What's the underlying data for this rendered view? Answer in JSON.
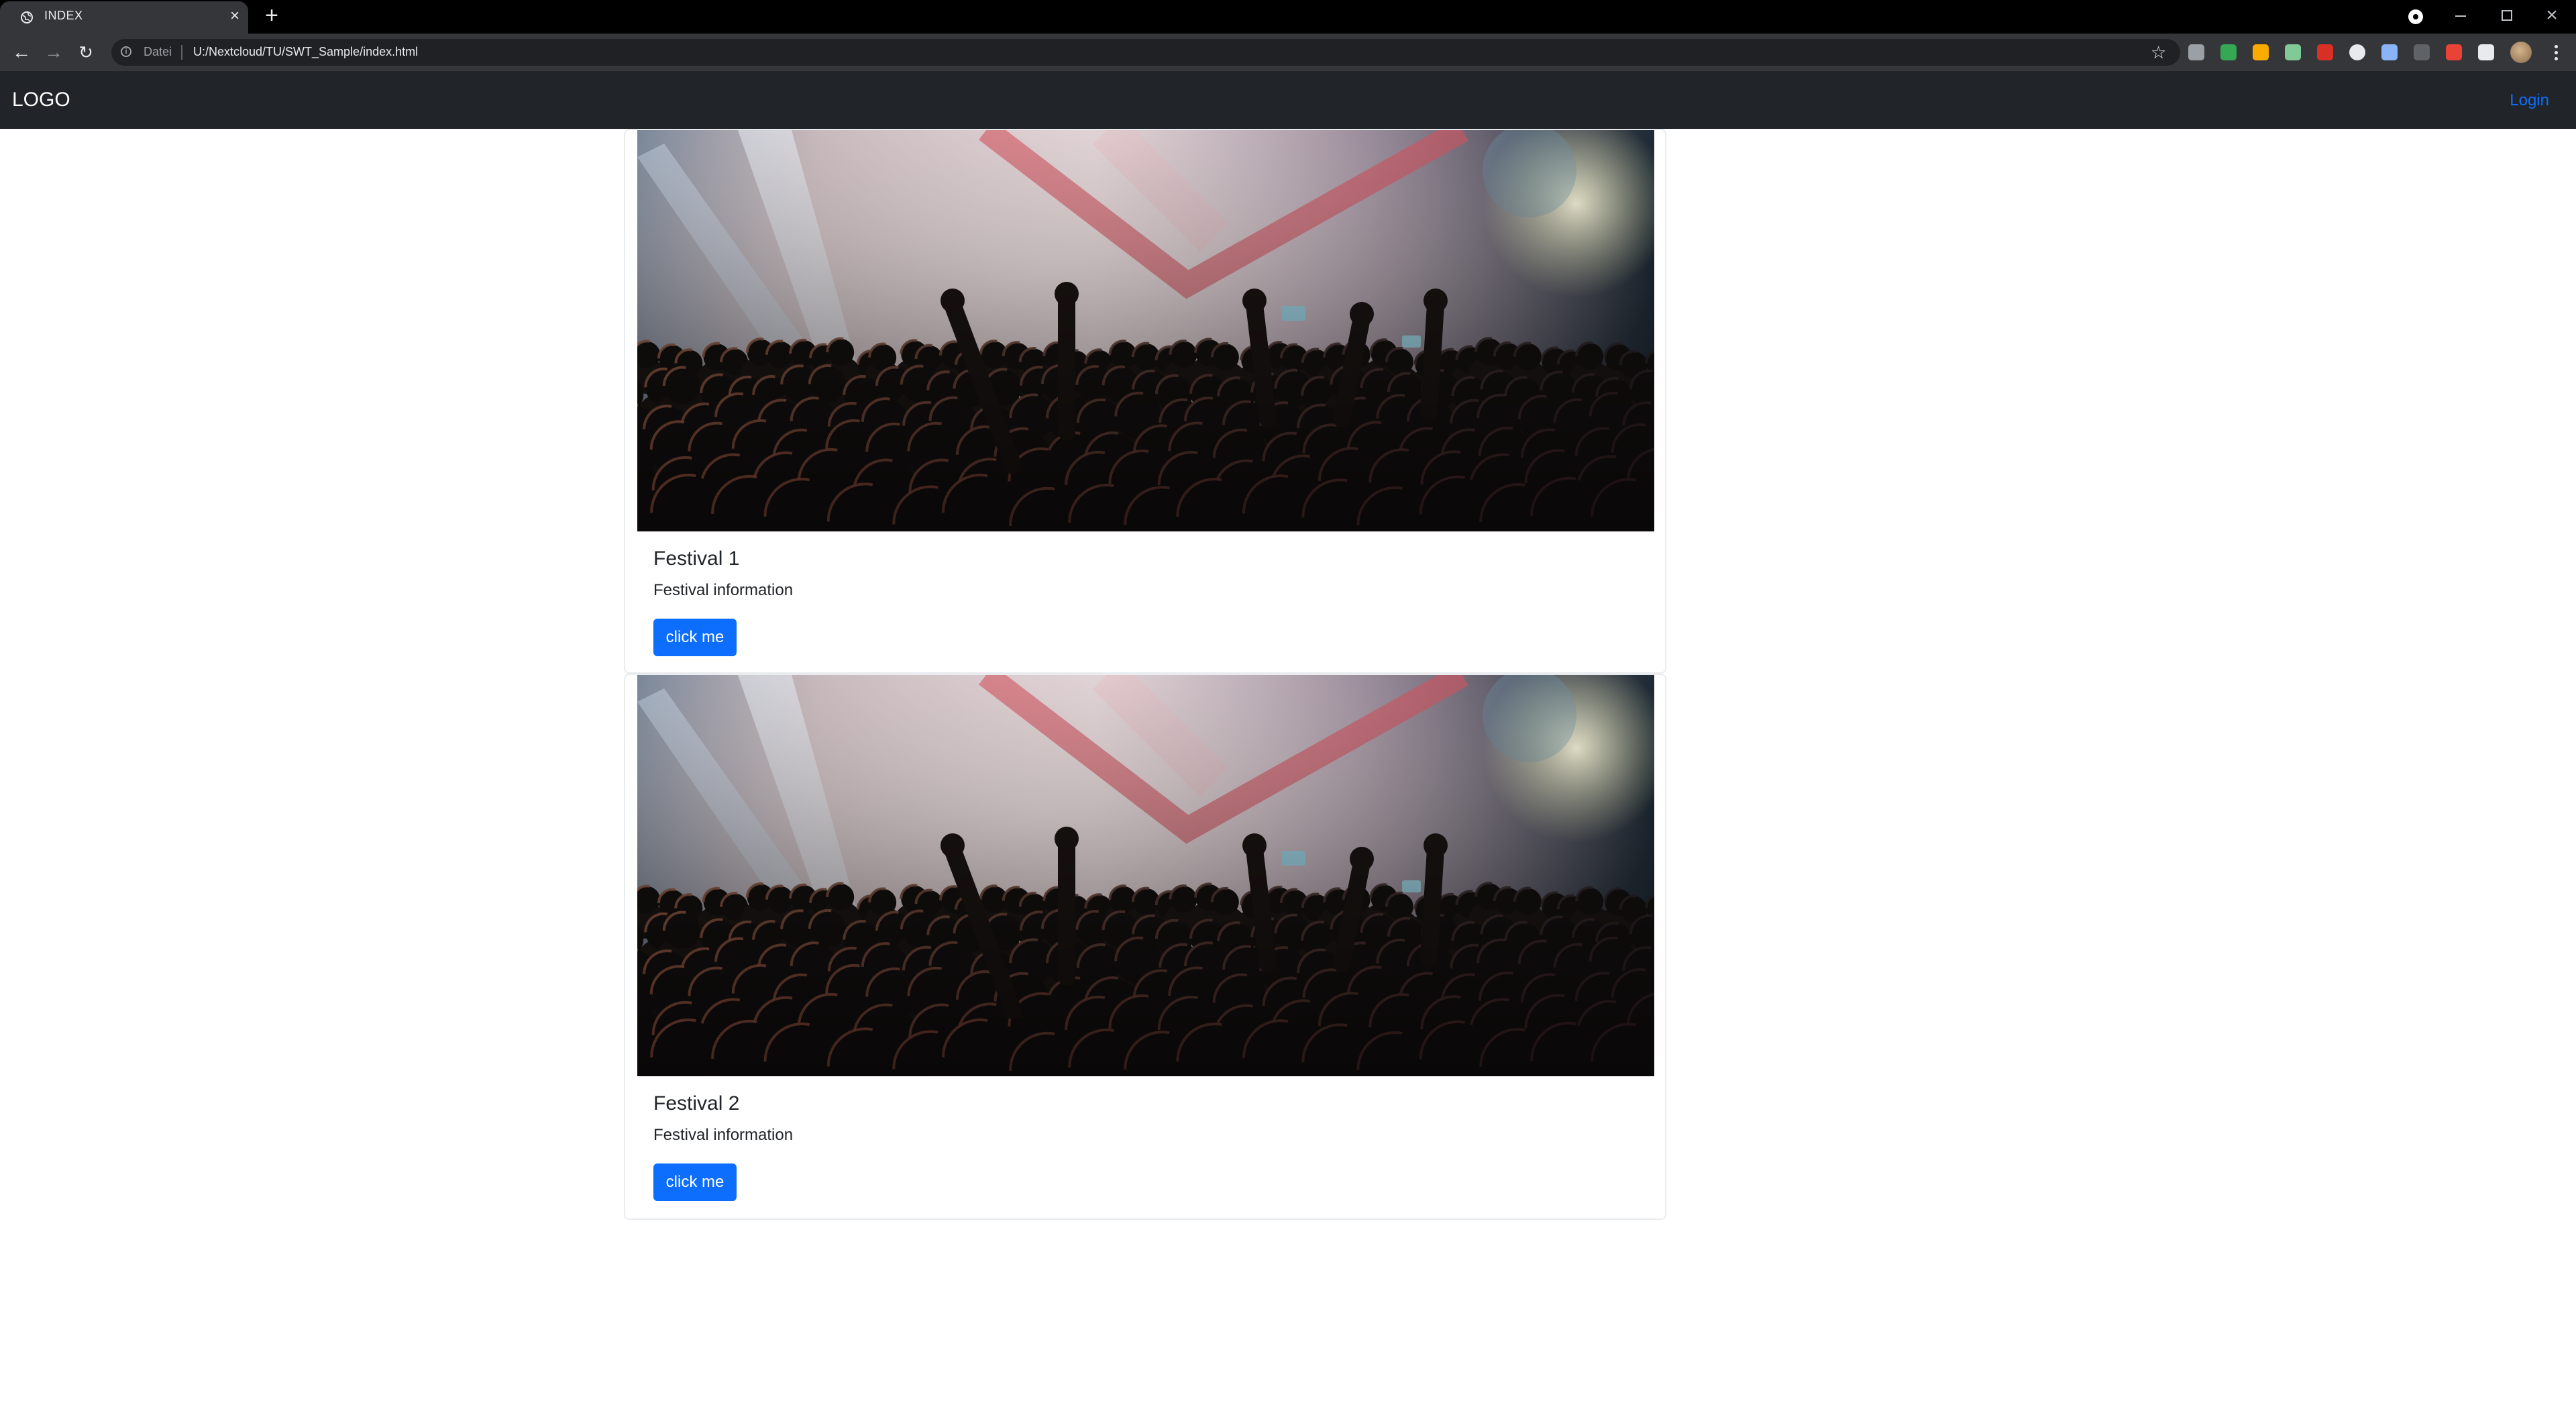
{
  "browser": {
    "tab": {
      "title": "INDEX",
      "close": "×"
    },
    "new_tab": "+",
    "window": {
      "close": "×"
    },
    "address": {
      "scheme": "Datei",
      "url": "U:/Nextcloud/TU/SWT_Sample/index.html"
    },
    "nav": {
      "back": "←",
      "forward": "→",
      "reload": "↻",
      "bookmark": "☆"
    },
    "extension_colors": [
      "#9aa0a6",
      "#34a853",
      "#f9ab00",
      "#81c995",
      "#d93025",
      "#e8eaed",
      "#8ab4f8",
      "#5f6368",
      "#ea4335",
      "#e8eaed"
    ]
  },
  "navbar": {
    "brand": "LOGO",
    "login": "Login"
  },
  "cards": [
    {
      "title": "Festival 1",
      "text": "Festival information",
      "button": "click me"
    },
    {
      "title": "Festival 2",
      "text": "Festival information",
      "button": "click me"
    }
  ],
  "colors": {
    "navbar_bg": "#212529",
    "button_bg": "#0d6efd",
    "link": "#0d6efd"
  }
}
